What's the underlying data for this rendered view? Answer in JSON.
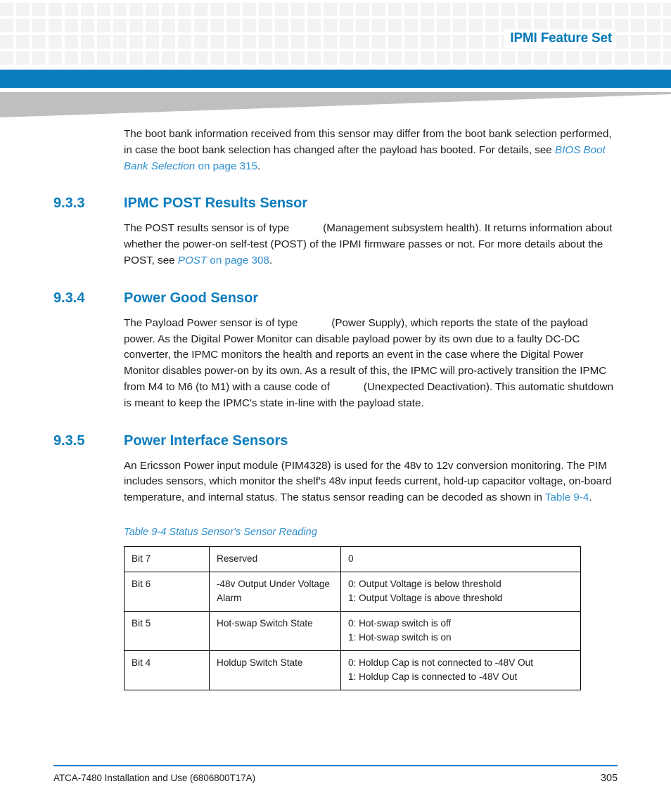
{
  "header": {
    "title": "IPMI Feature Set"
  },
  "colors": {
    "brand_blue": "#0b7cbd",
    "link_blue": "#2f8fd0",
    "grid_gray": "#f3f3f3",
    "swoosh_gray": "#bfbfbf"
  },
  "intro_paragraph": {
    "text_before_link": "The boot bank information received from this sensor may differ from the boot bank selection performed, in case the boot bank selection has changed after the payload has booted. For details, see ",
    "link_italic": "BIOS Boot Bank Selection",
    "link_page": " on page 315",
    "text_after": "."
  },
  "sections": [
    {
      "number": "9.3.3",
      "title": "IPMC POST Results Sensor",
      "paragraph": {
        "part1": "The POST results sensor is of type",
        "blank": "",
        "part2": "(Management subsystem health). It returns information about whether the power-on self-test (POST) of the IPMI firmware passes or not. For more details about the POST, see ",
        "link_italic": "POST",
        "link_page": " on page 308",
        "part3": "."
      }
    },
    {
      "number": "9.3.4",
      "title": "Power Good Sensor",
      "paragraph": {
        "part1": "The Payload Power sensor is of type",
        "blank": "",
        "part2": "(Power Supply), which reports the state of the payload power. As the Digital Power Monitor can disable payload power by its own due to a faulty DC-DC converter, the IPMC monitors the health and reports an event in the case where the Digital Power Monitor disables power-on by its own. As a result of this, the IPMC will pro-actively transition the IPMC from M4 to M6 (to M1) with a cause code of",
        "blank2": "",
        "part3": "(Unexpected Deactivation). This automatic shutdown is meant to keep the IPMC's state in-line with the payload state."
      }
    },
    {
      "number": "9.3.5",
      "title": "Power Interface Sensors",
      "paragraph": {
        "part1": "An Ericsson Power input module (PIM4328) is used for the 48v to 12v conversion monitoring. The PIM includes sensors, which monitor the shelf's 48v input feeds current, hold-up capacitor voltage, on-board temperature, and internal status. The status sensor reading can be decoded as shown in ",
        "link": "Table 9-4",
        "part2": "."
      }
    }
  ],
  "table": {
    "caption": "Table 9-4 Status Sensor's Sensor Reading",
    "rows": [
      {
        "bit": "Bit 7",
        "name": "Reserved",
        "desc_lines": [
          "0"
        ]
      },
      {
        "bit": "Bit 6",
        "name": "-48v Output Under Voltage Alarm",
        "desc_lines": [
          "0: Output Voltage is below threshold",
          "1: Output Voltage is above threshold"
        ]
      },
      {
        "bit": "Bit 5",
        "name": "Hot-swap Switch State",
        "desc_lines": [
          "0: Hot-swap switch is off",
          "1: Hot-swap switch is on"
        ]
      },
      {
        "bit": "Bit 4",
        "name": "Holdup Switch State",
        "desc_lines": [
          "0: Holdup Cap is not connected to -48V Out",
          "1: Holdup Cap is connected to -48V Out"
        ]
      }
    ]
  },
  "footer": {
    "document_title": "ATCA-7480 Installation and Use (6806800T17A)",
    "page_number": "305"
  }
}
